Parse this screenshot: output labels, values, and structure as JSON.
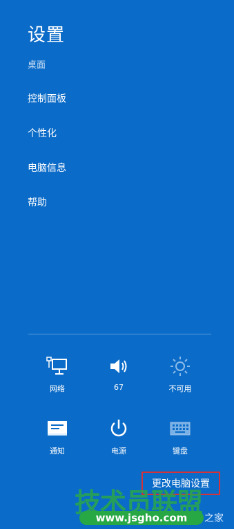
{
  "panel": {
    "title": "设置",
    "subtitle": "桌面",
    "menu": [
      {
        "label": "控制面板"
      },
      {
        "label": "个性化"
      },
      {
        "label": "电脑信息"
      },
      {
        "label": "帮助"
      }
    ]
  },
  "quick_settings": [
    {
      "label": "网络",
      "icon": "network-icon"
    },
    {
      "label": "67",
      "icon": "volume-icon"
    },
    {
      "label": "不可用",
      "icon": "brightness-icon"
    },
    {
      "label": "通知",
      "icon": "notifications-icon"
    },
    {
      "label": "电源",
      "icon": "power-icon"
    },
    {
      "label": "键盘",
      "icon": "keyboard-icon"
    }
  ],
  "footer": {
    "change_pc_settings": "更改电脑设置"
  },
  "watermark": {
    "brand": "技术员联盟",
    "url": "www.jsgho.com",
    "tail": "之家"
  },
  "colors": {
    "background": "#0b6bc8",
    "divider": "#5b9ddc",
    "highlight_border": "#d3333a",
    "watermark_green": "#27a845"
  }
}
